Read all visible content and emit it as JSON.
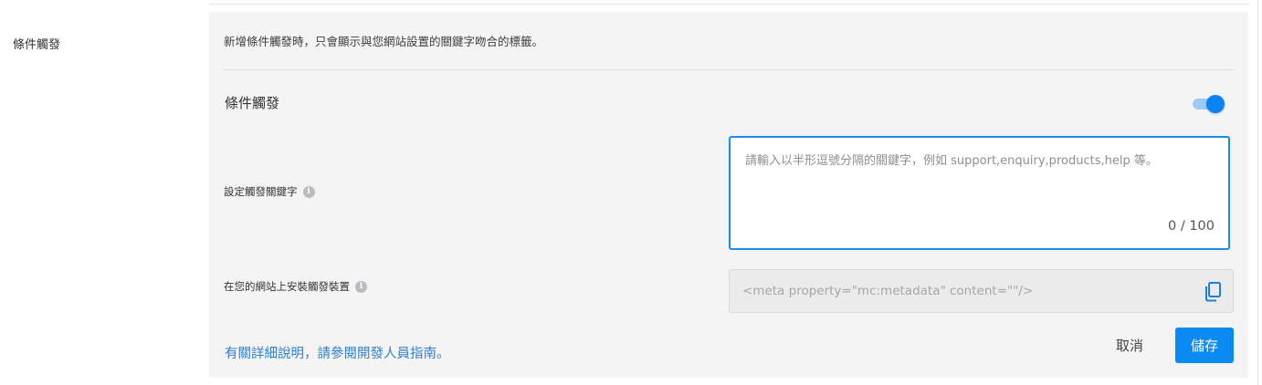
{
  "section": {
    "label": "條件觸發"
  },
  "panel": {
    "description": "新增條件觸發時，只會顯示與您網站設置的關鍵字吻合的標籤。",
    "toggle": {
      "label": "條件觸發",
      "enabled": true
    },
    "keywords": {
      "label": "設定觸發關鍵字",
      "placeholder": "請輸入以半形逗號分隔的關鍵字，例如 support,enquiry,products,help 等。",
      "counter": "0 / 100"
    },
    "install": {
      "label": "在您的網站上安裝觸發裝置",
      "code": "<meta property=\"mc:metadata\" content=\"\"/>"
    },
    "guide_link": "有關詳細說明，請參閱開發人員指南。",
    "actions": {
      "cancel": "取消",
      "save": "儲存"
    }
  },
  "icons": {
    "info": "info-icon",
    "copy": "copy-icon"
  },
  "colors": {
    "accent": "#0a8af3",
    "link": "#2f7fd0",
    "panel_bg": "#f4f4f5"
  }
}
